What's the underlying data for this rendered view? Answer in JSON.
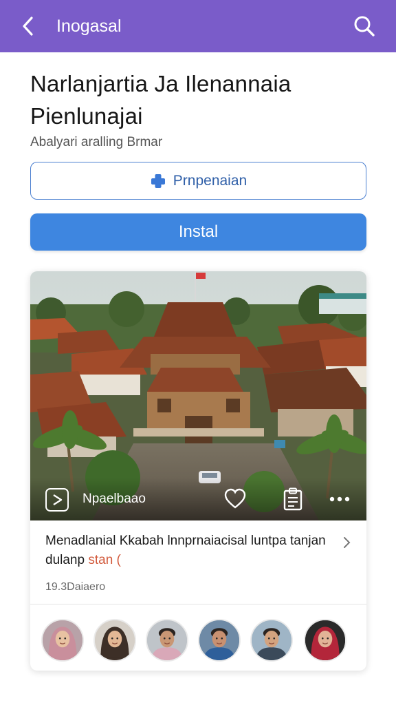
{
  "topbar": {
    "title": "Inogasal",
    "back_icon": "chevron-left-icon",
    "search_icon": "search-icon",
    "color": "#7a5cc9"
  },
  "app": {
    "title": "Narlanjartia Ja Ilenannaia Pienlunajai",
    "subtitle": "Abalyari aralling Brmar"
  },
  "actions": {
    "secondary_label": "Prnpenaian",
    "secondary_icon": "plus-icon",
    "primary_label": "Instal",
    "primary_color": "#3e86e0"
  },
  "card": {
    "media_label": "Npaelbaao",
    "headline": "Menadlanial Kkabah lnnprnaiacisal luntpa tanjan dulanp",
    "headline_highlight": "stan (",
    "meta": "19.3Daiaero",
    "icons": [
      "play-icon",
      "heart-icon",
      "clipboard-icon",
      "more-icon",
      "chevron-right-icon"
    ]
  },
  "avatars": [
    {
      "name": "avatar-1",
      "bg": "#b8a2a8",
      "skin": "#e8c2a2",
      "cloth": "#c98f9c",
      "hijab": true
    },
    {
      "name": "avatar-2",
      "bg": "#d6d0c8",
      "skin": "#e3b895",
      "cloth": "#3d2f27",
      "hijab": true
    },
    {
      "name": "avatar-3",
      "bg": "#bfc4c9",
      "skin": "#c99774",
      "cloth": "#d9a8b8",
      "hijab": false
    },
    {
      "name": "avatar-4",
      "bg": "#6e8aa6",
      "skin": "#c89171",
      "cloth": "#2e5f9a",
      "hijab": false
    },
    {
      "name": "avatar-5",
      "bg": "#9fb5c6",
      "skin": "#d3a37f",
      "cloth": "#3b4a5a",
      "hijab": false
    },
    {
      "name": "avatar-6",
      "bg": "#2a2a2a",
      "skin": "#e2b497",
      "cloth": "#b3263a",
      "hijab": true
    }
  ]
}
